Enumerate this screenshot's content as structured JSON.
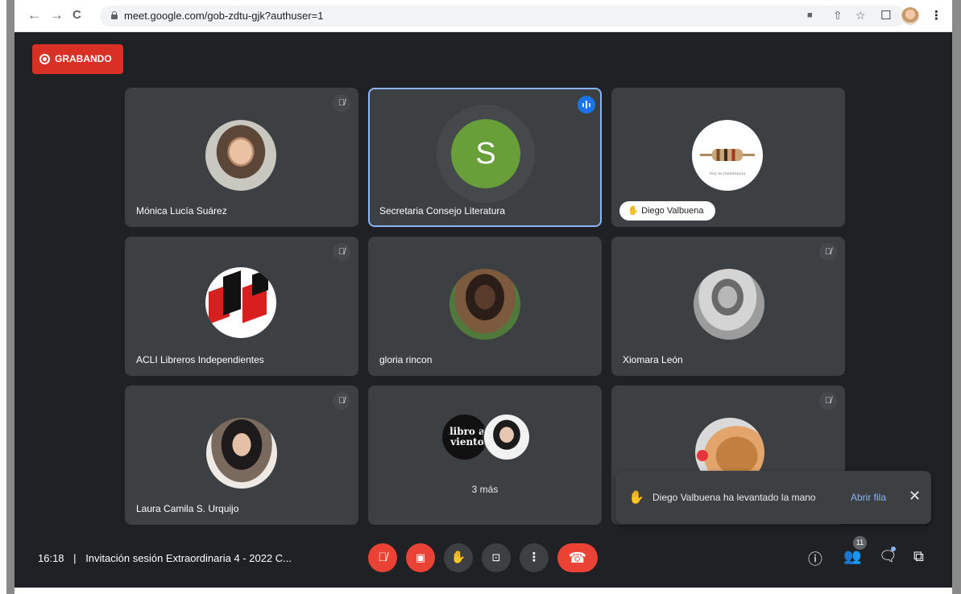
{
  "browser": {
    "url": "meet.google.com/gob-zdtu-gjk?authuser=1",
    "back_icon": "←",
    "forward_icon": "→",
    "reload_icon": "C",
    "icons": [
      "camera-icon",
      "share-icon",
      "star-icon",
      "tab-icon",
      "profile-icon",
      "menu-icon"
    ]
  },
  "recording": {
    "label": "GRABANDO",
    "color": "#d93025"
  },
  "tiles": [
    {
      "name": "Mónica Lucía Suárez",
      "muted": true
    },
    {
      "name": "Secretaria Consejo Literatura",
      "initial": "S",
      "speaking": true,
      "avatar_color": "#689f38"
    },
    {
      "name": "Diego Valbuena",
      "hand_raised": true,
      "image_caption": "Soy la resistencia"
    },
    {
      "name": "ACLI Libreros Independientes",
      "muted": true
    },
    {
      "name": "gloria rincon"
    },
    {
      "name": "Xiomara León",
      "muted": true
    },
    {
      "name": "Laura Camila S. Urquijo",
      "muted": true
    },
    {
      "more_label": "3 más",
      "mini_text": "libro a viento"
    },
    {
      "name": "",
      "muted": true
    }
  ],
  "toast": {
    "text": "Diego Valbuena ha levantado la mano",
    "action": "Abrir fila",
    "close_icon": "✕"
  },
  "bottom_bar": {
    "time": "16:18",
    "separator": "|",
    "meeting_title": "Invitación sesión Extraordinaria 4 - 2022 C...",
    "participants_count": "11",
    "accent_color": "#ea4335"
  }
}
